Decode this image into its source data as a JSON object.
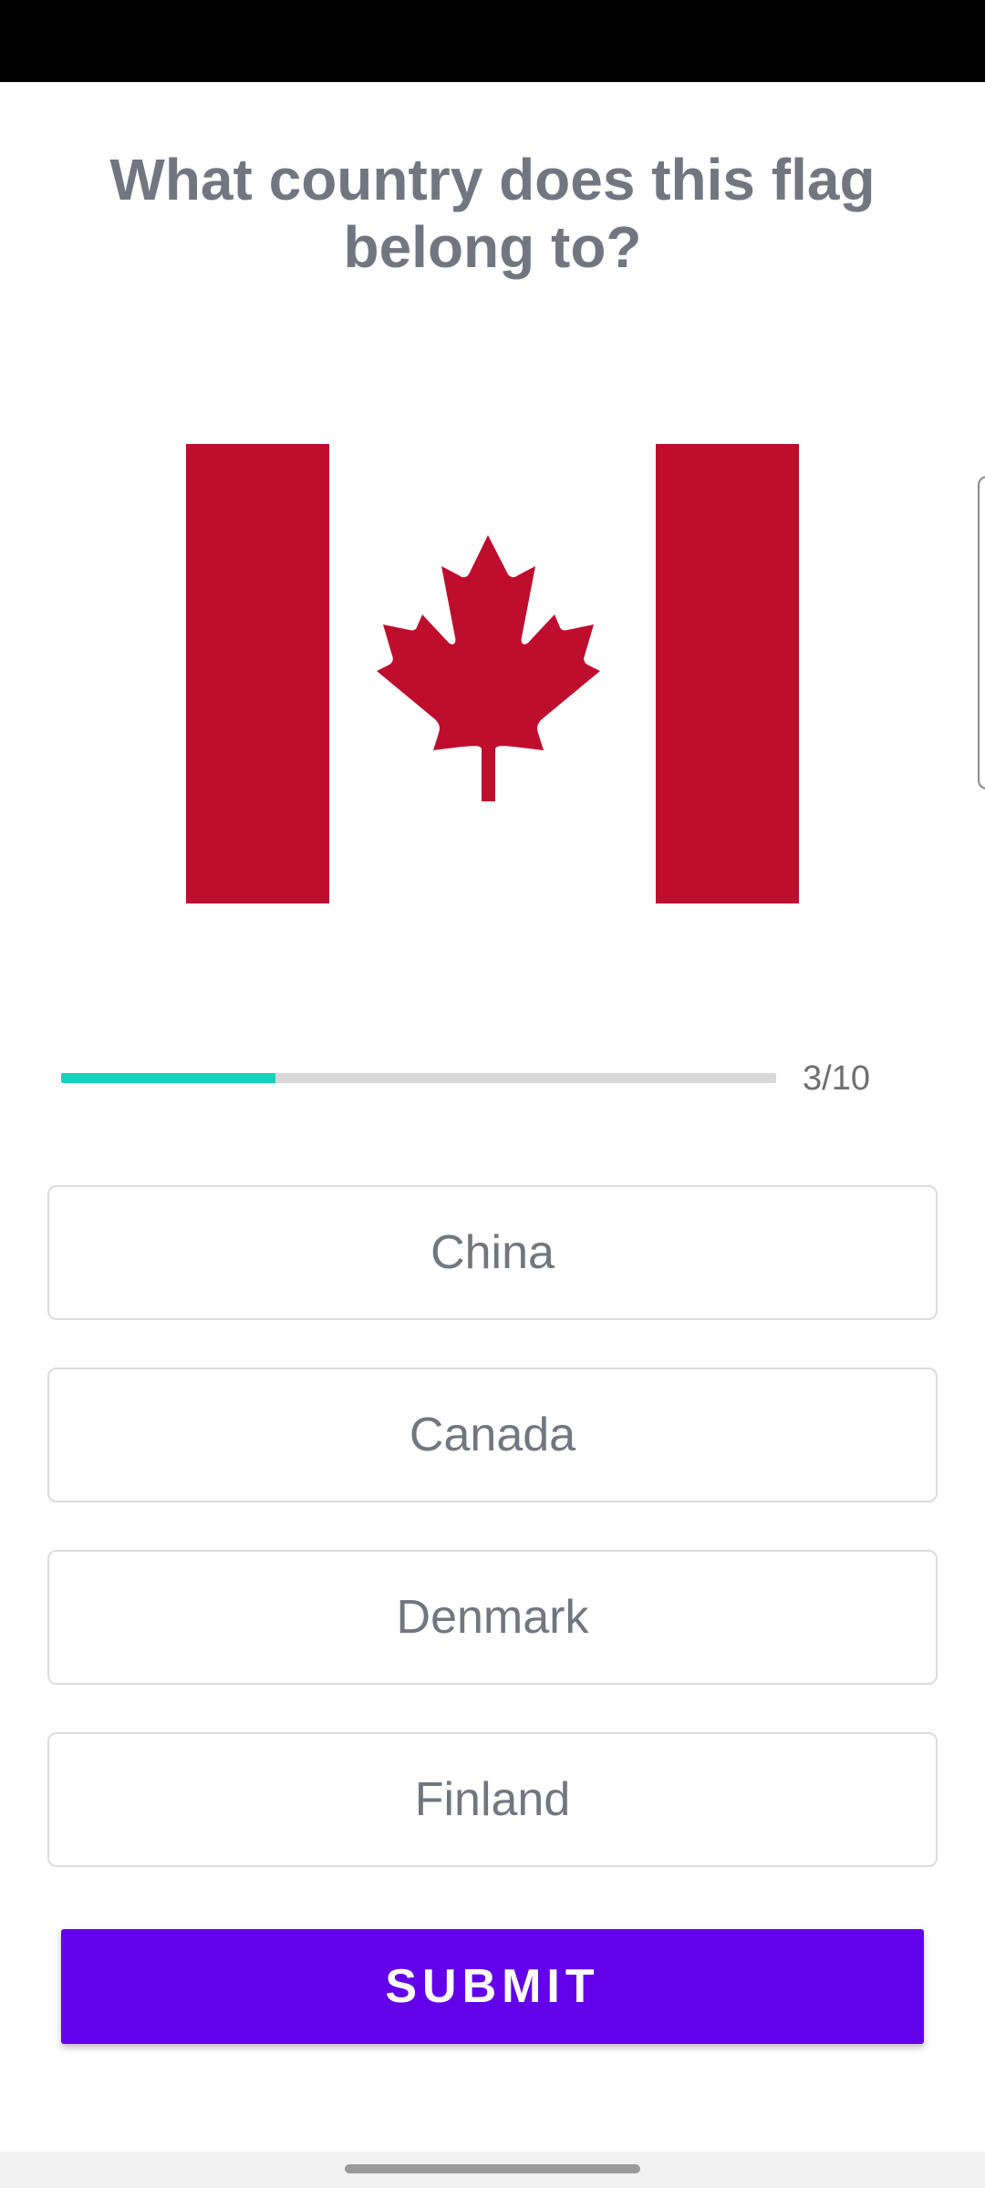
{
  "question": {
    "text": "What country does this flag belong to?"
  },
  "flag": {
    "icon": "canada-flag",
    "colors": {
      "red": "#bf0d2e",
      "white": "#ffffff"
    }
  },
  "progress": {
    "label": "3/10",
    "current": 3,
    "total": 10,
    "fraction": 0.3,
    "fill_color": "#14d2bd",
    "track_color": "#d8d8d8"
  },
  "options": [
    {
      "label": "China"
    },
    {
      "label": "Canada"
    },
    {
      "label": "Denmark"
    },
    {
      "label": "Finland"
    }
  ],
  "submit": {
    "label": "SUBMIT",
    "color": "#6200ea"
  },
  "colors": {
    "question_text": "#737680",
    "status_bar": "#000000"
  }
}
